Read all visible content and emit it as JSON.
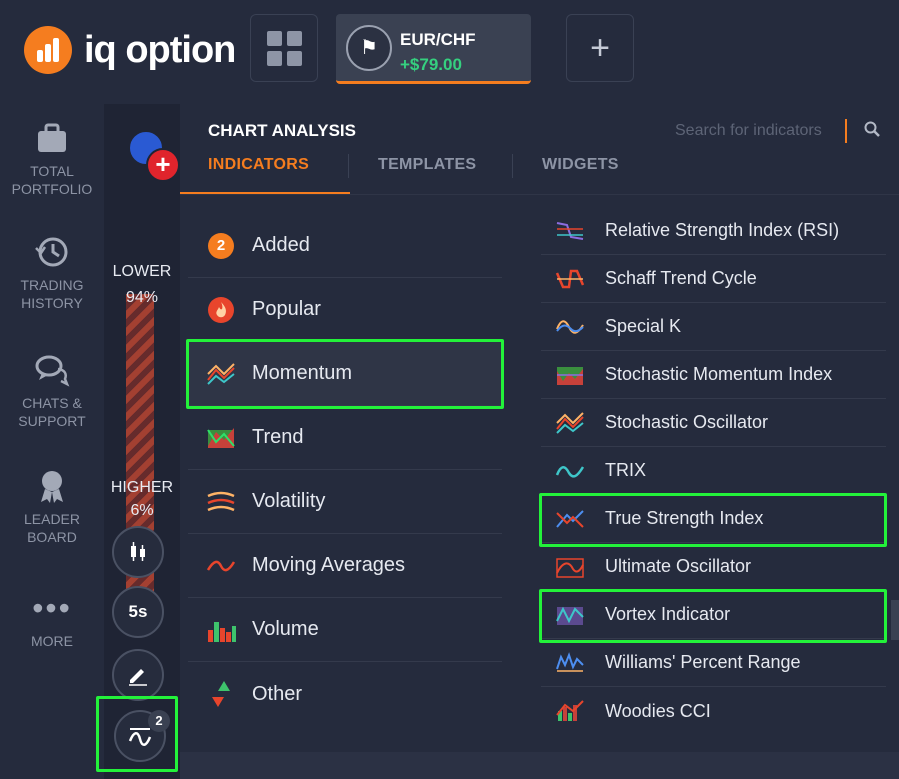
{
  "header": {
    "logo_text": "iq option",
    "asset": {
      "name": "EUR/CHF",
      "profit": "+$79.00",
      "icon": "flag-icon"
    },
    "add_symbol": "+"
  },
  "sidebar": {
    "items": [
      {
        "label": "TOTAL\nPORTFOLIO",
        "icon": "briefcase-icon"
      },
      {
        "label": "TRADING\nHISTORY",
        "icon": "history-icon"
      },
      {
        "label": "CHATS &\nSUPPORT",
        "icon": "chat-icon"
      },
      {
        "label": "LEADER\nBOARD",
        "icon": "medal-icon"
      },
      {
        "label": "MORE",
        "icon": "more-icon"
      }
    ]
  },
  "chart": {
    "lower_label": "LOWER",
    "lower_pct": "94%",
    "higher_label": "HIGHER",
    "higher_pct": "6%",
    "timeframe": "5s",
    "indicators_count": "2"
  },
  "panel": {
    "title": "CHART ANALYSIS",
    "search_placeholder": "Search for indicators",
    "tabs": [
      "INDICATORS",
      "TEMPLATES",
      "WIDGETS"
    ],
    "active_tab": "INDICATORS",
    "categories": [
      {
        "label": "Added",
        "badge": "2",
        "icon": "count-badge"
      },
      {
        "label": "Popular",
        "icon": "fire-icon"
      },
      {
        "label": "Momentum",
        "icon": "momentum-icon",
        "active": true
      },
      {
        "label": "Trend",
        "icon": "trend-icon"
      },
      {
        "label": "Volatility",
        "icon": "volatility-icon"
      },
      {
        "label": "Moving Averages",
        "icon": "moving-average-icon"
      },
      {
        "label": "Volume",
        "icon": "volume-icon"
      },
      {
        "label": "Other",
        "icon": "other-icon"
      }
    ],
    "indicators": [
      {
        "label": "Relative Strength Index (RSI)",
        "icon": "rsi-icon"
      },
      {
        "label": "Schaff Trend Cycle",
        "icon": "schaff-icon"
      },
      {
        "label": "Special K",
        "icon": "special-k-icon"
      },
      {
        "label": "Stochastic Momentum Index",
        "icon": "smi-icon"
      },
      {
        "label": "Stochastic Oscillator",
        "icon": "stochastic-icon"
      },
      {
        "label": "TRIX",
        "icon": "trix-icon"
      },
      {
        "label": "True Strength Index",
        "icon": "tsi-icon",
        "highlighted": true
      },
      {
        "label": "Ultimate Oscillator",
        "icon": "ultimate-icon"
      },
      {
        "label": "Vortex Indicator",
        "icon": "vortex-icon",
        "highlighted": true
      },
      {
        "label": "Williams' Percent Range",
        "icon": "williams-icon"
      },
      {
        "label": "Woodies CCI",
        "icon": "woodies-icon"
      }
    ]
  },
  "colors": {
    "accent": "#f57d1f",
    "profit": "#35d07f",
    "highlight": "#23f23a",
    "background": "#1e2333",
    "panel": "#252b3d"
  }
}
